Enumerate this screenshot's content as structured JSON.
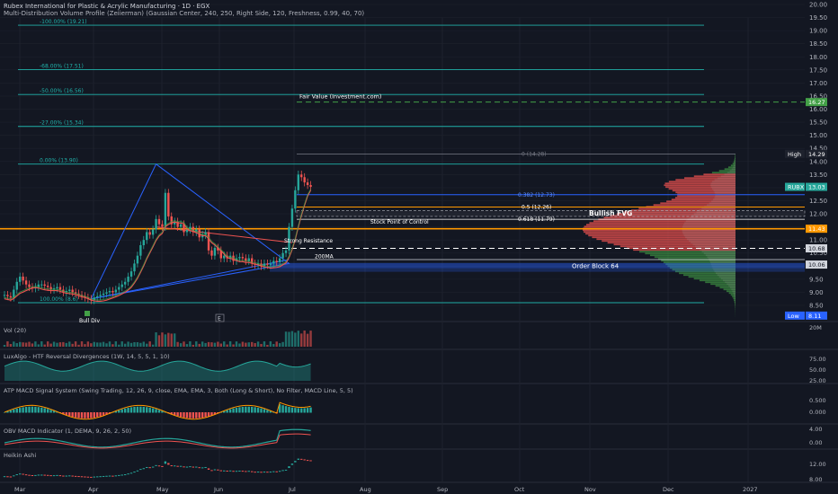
{
  "header": {
    "title": "Rubex International for Plastic & Acrylic Manufacturing · 1D · EGX",
    "study": "Multi-Distribution Volume Profile (Zeiierman) (Gaussian Center, 240, 250, Right Side, 120, Freshness, 0.99, 40, 70)"
  },
  "panes": {
    "vol": "Vol (20)",
    "lux": "LuxAlgo - HTF Reversal Divergences (1W, 14, 5, 5, 1, 10)",
    "atp": "ATP MACD Signal System (Swing Trading, 12, 26, 9, close, EMA, EMA, 3, Both (Long & Short), No Filter, MACD Line, 5, 5)",
    "obv": "OBV MACD Indicator (1, DEMA, 9, 26, 2, 50)",
    "ha": "Heikin Ashi"
  },
  "colors": {
    "bg": "#131722",
    "grid": "#1e222d",
    "up": "#26a69a",
    "down": "#ef5350",
    "teal": "#20b2aa",
    "orange": "#ff9800",
    "blue": "#2962ff",
    "green": "#43a047"
  },
  "chart_data": {
    "type": "line",
    "symbol": "RUBX",
    "last_price": "13.03",
    "x_ticks": [
      "Mar",
      "Apr",
      "May",
      "Jun",
      "Jul",
      "Aug",
      "Sep",
      "Oct",
      "Nov",
      "Dec",
      "2027"
    ],
    "price_axis": {
      "ylim": [
        8.0,
        20.0
      ],
      "ticks": [
        "20.00",
        "19.50",
        "19.00",
        "18.50",
        "18.00",
        "17.50",
        "17.00",
        "16.50",
        "16.00",
        "15.50",
        "15.00",
        "14.50",
        "14.00",
        "13.50",
        "13.00",
        "12.50",
        "12.00",
        "11.50",
        "11.00",
        "10.50",
        "10.00",
        "9.50",
        "9.00",
        "8.50"
      ]
    },
    "price_badges": [
      {
        "label": "16.27",
        "price": 16.27,
        "color": "#43a047"
      },
      {
        "label": "High",
        "value": "14.29",
        "price": 14.29,
        "color": "#1e222d"
      },
      {
        "label": "RUBX",
        "value": "13.03",
        "price": 13.03,
        "color": "#26a69a"
      },
      {
        "label": "11.43",
        "price": 11.43,
        "color": "#ff9800"
      },
      {
        "label": "10.68",
        "price": 10.68,
        "color": "#d1d4dc"
      },
      {
        "label": "10.06",
        "price": 10.06,
        "color": "#d1d4dc"
      },
      {
        "label": "Low",
        "value": "8.11",
        "price": 8.11,
        "color": "#2962ff"
      }
    ],
    "fib_levels": [
      {
        "label": "-100.00% (19.21)",
        "price": 19.21
      },
      {
        "label": "-68.00% (17.51)",
        "price": 17.51
      },
      {
        "label": "-50.00% (16.56)",
        "price": 16.56
      },
      {
        "label": "-27.00% (15.34)",
        "price": 15.34
      },
      {
        "label": "0.00% (13.90)",
        "price": 13.9
      },
      {
        "label": "100.00% (8.6)",
        "price": 8.6
      }
    ],
    "levels": [
      {
        "label": "0 (14.28)",
        "price": 14.28
      },
      {
        "label": "0.382 (12.73)",
        "price": 12.73
      },
      {
        "label": "0.5 (12.26)",
        "price": 12.26
      },
      {
        "label": "0.618 (11.79)",
        "price": 11.79
      }
    ],
    "annotations": [
      {
        "text": "Fair Value (Investment.com)",
        "price": 16.27
      },
      {
        "text": "Bullish FVG",
        "price": 12.0
      },
      {
        "text": "Stock Point of Control",
        "price": 11.6
      },
      {
        "text": "Strong Resistance",
        "price": 10.95
      },
      {
        "text": "200MA",
        "price": 10.25
      },
      {
        "text": "Order Block 64",
        "price": 10.0
      },
      {
        "text": "Bull Div",
        "price": 8.35
      },
      {
        "text": "E",
        "price": 8.35
      }
    ],
    "close": [
      8.9,
      8.85,
      8.8,
      9.1,
      9.4,
      9.6,
      9.45,
      9.3,
      9.2,
      9.15,
      9.2,
      9.3,
      9.3,
      9.25,
      9.2,
      9.1,
      9.15,
      9.2,
      9.1,
      9.0,
      9.05,
      9.1,
      9.0,
      8.95,
      8.9,
      8.85,
      8.8,
      8.75,
      8.7,
      8.8,
      8.85,
      8.9,
      8.95,
      9.0,
      9.05,
      9.0,
      9.1,
      9.2,
      9.3,
      9.4,
      9.6,
      9.8,
      10.1,
      10.4,
      10.8,
      11.0,
      11.3,
      11.2,
      11.4,
      11.8,
      11.6,
      11.5,
      12.8,
      11.9,
      11.6,
      11.7,
      11.5,
      11.6,
      11.3,
      11.4,
      11.5,
      11.3,
      11.4,
      11.1,
      11.2,
      11.3,
      10.6,
      10.4,
      10.7,
      10.6,
      10.3,
      10.4,
      10.3,
      10.4,
      10.2,
      10.3,
      10.35,
      10.3,
      10.2,
      10.3,
      10.1,
      10.05,
      10.1,
      10.0,
      10.1,
      10.05,
      10.1,
      10.2,
      10.15,
      10.3,
      10.5,
      10.6,
      11.5,
      12.2,
      12.9,
      13.5,
      13.4,
      13.2,
      13.1,
      13.03
    ],
    "volume_profile": {
      "poc": 11.43,
      "range": [
        8.11,
        14.29
      ]
    },
    "vol_pane": {
      "ticks": [
        "20M"
      ]
    },
    "lux_pane": {
      "ticks": [
        "75.00",
        "50.00",
        "25.00"
      ]
    },
    "atp_pane": {
      "ticks": [
        "0.500",
        "0.000"
      ]
    },
    "obv_pane": {
      "ticks": [
        "4.00",
        "0.00"
      ]
    },
    "ha_pane": {
      "ticks": [
        "12.00",
        "8.00"
      ]
    }
  }
}
